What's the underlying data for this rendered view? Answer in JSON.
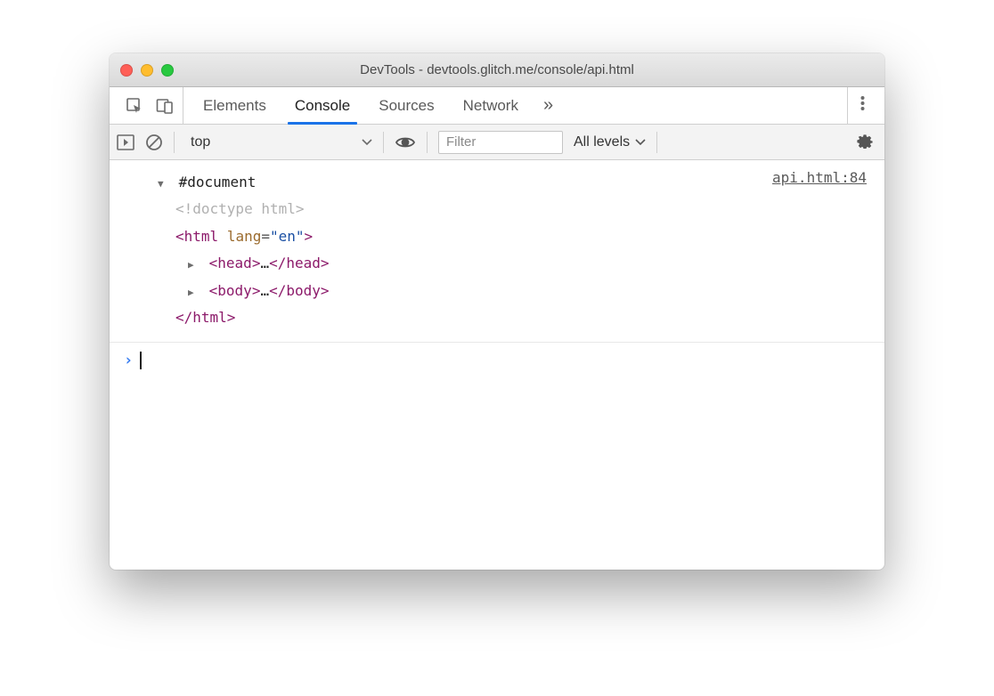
{
  "window": {
    "title": "DevTools - devtools.glitch.me/console/api.html"
  },
  "tabs": {
    "items": [
      "Elements",
      "Console",
      "Sources",
      "Network"
    ],
    "active_index": 1,
    "overflow_glyph": "»"
  },
  "filterbar": {
    "context": "top",
    "filter_placeholder": "Filter",
    "levels_label": "All levels"
  },
  "console": {
    "source_link": "api.html:84",
    "tree": {
      "root_label": "#document",
      "doctype": "<!doctype html>",
      "html_open_tag": "html",
      "html_attr_name": "lang",
      "html_attr_value": "\"en\"",
      "head_tag": "head",
      "body_tag": "body",
      "html_close": "</html>",
      "ellipsis": "…"
    }
  }
}
